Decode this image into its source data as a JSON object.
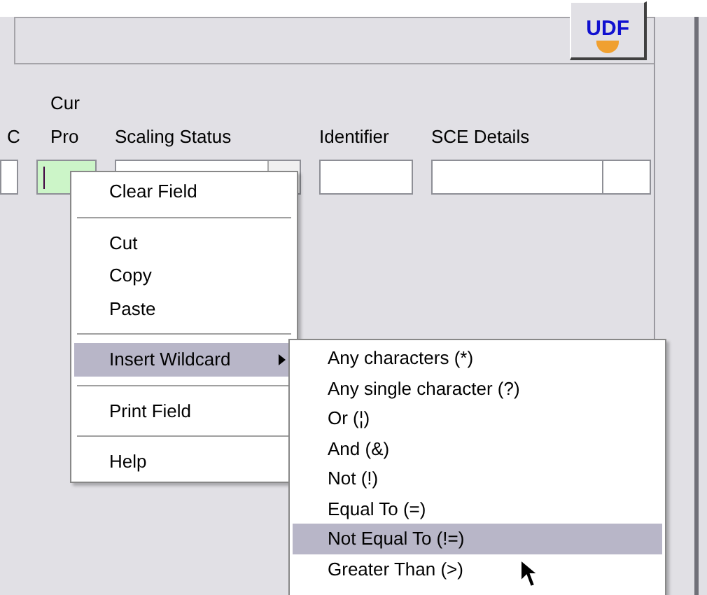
{
  "toolbar": {
    "logo_button": "UDF"
  },
  "columns": [
    {
      "label": "C",
      "kind": "text",
      "focused": false
    },
    {
      "label": "Cur Pro",
      "kind": "text",
      "focused": true
    },
    {
      "label": "Scaling Status",
      "kind": "combo",
      "focused": false
    },
    {
      "label": "Identifier",
      "kind": "text",
      "focused": false
    },
    {
      "label": "SCE Details",
      "kind": "split",
      "focused": false
    }
  ],
  "context_menu": [
    {
      "kind": "item",
      "label": "Clear Field",
      "submenu": false,
      "selected": false
    },
    {
      "kind": "separator"
    },
    {
      "kind": "item",
      "label": "Cut",
      "submenu": false,
      "selected": false
    },
    {
      "kind": "item",
      "label": "Copy",
      "submenu": false,
      "selected": false
    },
    {
      "kind": "item",
      "label": "Paste",
      "submenu": false,
      "selected": false
    },
    {
      "kind": "separator"
    },
    {
      "kind": "item",
      "label": "Insert Wildcard",
      "submenu": true,
      "selected": true
    },
    {
      "kind": "separator"
    },
    {
      "kind": "item",
      "label": "Print Field",
      "submenu": false,
      "selected": false
    },
    {
      "kind": "separator"
    },
    {
      "kind": "item",
      "label": "Help",
      "submenu": false,
      "selected": false
    }
  ],
  "wildcard_menu": [
    {
      "kind": "item",
      "label": "Any characters (*)",
      "submenu": false,
      "selected": false
    },
    {
      "kind": "item",
      "label": "Any single character (?)",
      "submenu": false,
      "selected": false
    },
    {
      "kind": "item",
      "label": "Or (¦)",
      "submenu": false,
      "selected": false
    },
    {
      "kind": "item",
      "label": "And (&)",
      "submenu": false,
      "selected": false
    },
    {
      "kind": "item",
      "label": "Not (!)",
      "submenu": false,
      "selected": false
    },
    {
      "kind": "item",
      "label": "Equal To (=)",
      "submenu": false,
      "selected": false
    },
    {
      "kind": "item",
      "label": "Not Equal To (!=)",
      "submenu": false,
      "selected": true
    },
    {
      "kind": "item",
      "label": "Greater Than (>)",
      "submenu": false,
      "selected": false
    }
  ]
}
